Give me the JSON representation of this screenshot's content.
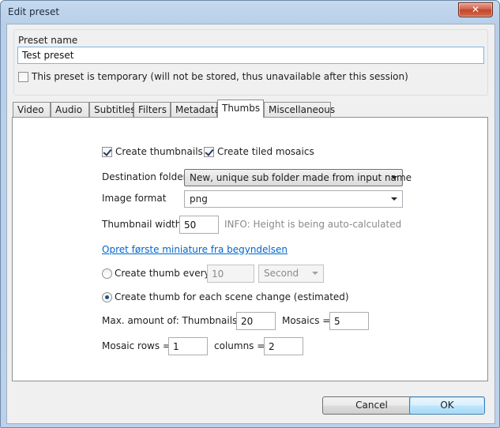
{
  "window": {
    "title": "Edit preset",
    "close_glyph": "✕"
  },
  "preset": {
    "group_label": "Preset name",
    "name_value": "Test preset",
    "temporary_label": "This preset is temporary (will not be stored, thus unavailable after this session)",
    "temporary_checked": false
  },
  "tabs": [
    {
      "label": "Video",
      "active": false
    },
    {
      "label": "Audio",
      "active": false
    },
    {
      "label": "Subtitles",
      "active": false
    },
    {
      "label": "Filters",
      "active": false
    },
    {
      "label": "Metadata",
      "active": false
    },
    {
      "label": "Thumbs",
      "active": true
    },
    {
      "label": "Miscellaneous",
      "active": false
    }
  ],
  "thumbs": {
    "create_thumbnails_label": "Create thumbnails",
    "create_thumbnails_checked": true,
    "create_mosaics_label": "Create tiled mosaics",
    "create_mosaics_checked": true,
    "destination_label": "Destination folder:",
    "destination_value": "New, unique sub folder made from input name",
    "image_format_label": "Image format",
    "image_format_value": "png",
    "thumb_width_label": "Thumbnail width",
    "thumb_width_value": "50",
    "thumb_width_info": "INFO: Height is being auto-calculated",
    "first_thumb_link": "Opret første miniature fra begyndelsen",
    "every_label": "Create thumb every",
    "every_value": "10",
    "every_unit": "Second",
    "every_selected": false,
    "scene_label": "Create thumb for each scene change (estimated)",
    "scene_selected": true,
    "max_thumbs_label": "Max. amount of: Thumbnails =",
    "max_thumbs_value": "20",
    "max_mosaics_label": "Mosaics =",
    "max_mosaics_value": "5",
    "mosaic_rows_label": "Mosaic rows =",
    "mosaic_rows_value": "1",
    "mosaic_cols_label": "columns =",
    "mosaic_cols_value": "2"
  },
  "buttons": {
    "cancel": "Cancel",
    "ok": "OK"
  },
  "colors": {
    "link": "#0066cc",
    "info": "#8a8a8a",
    "window_frame": "#bcd1ea",
    "close": "#c2452c"
  }
}
